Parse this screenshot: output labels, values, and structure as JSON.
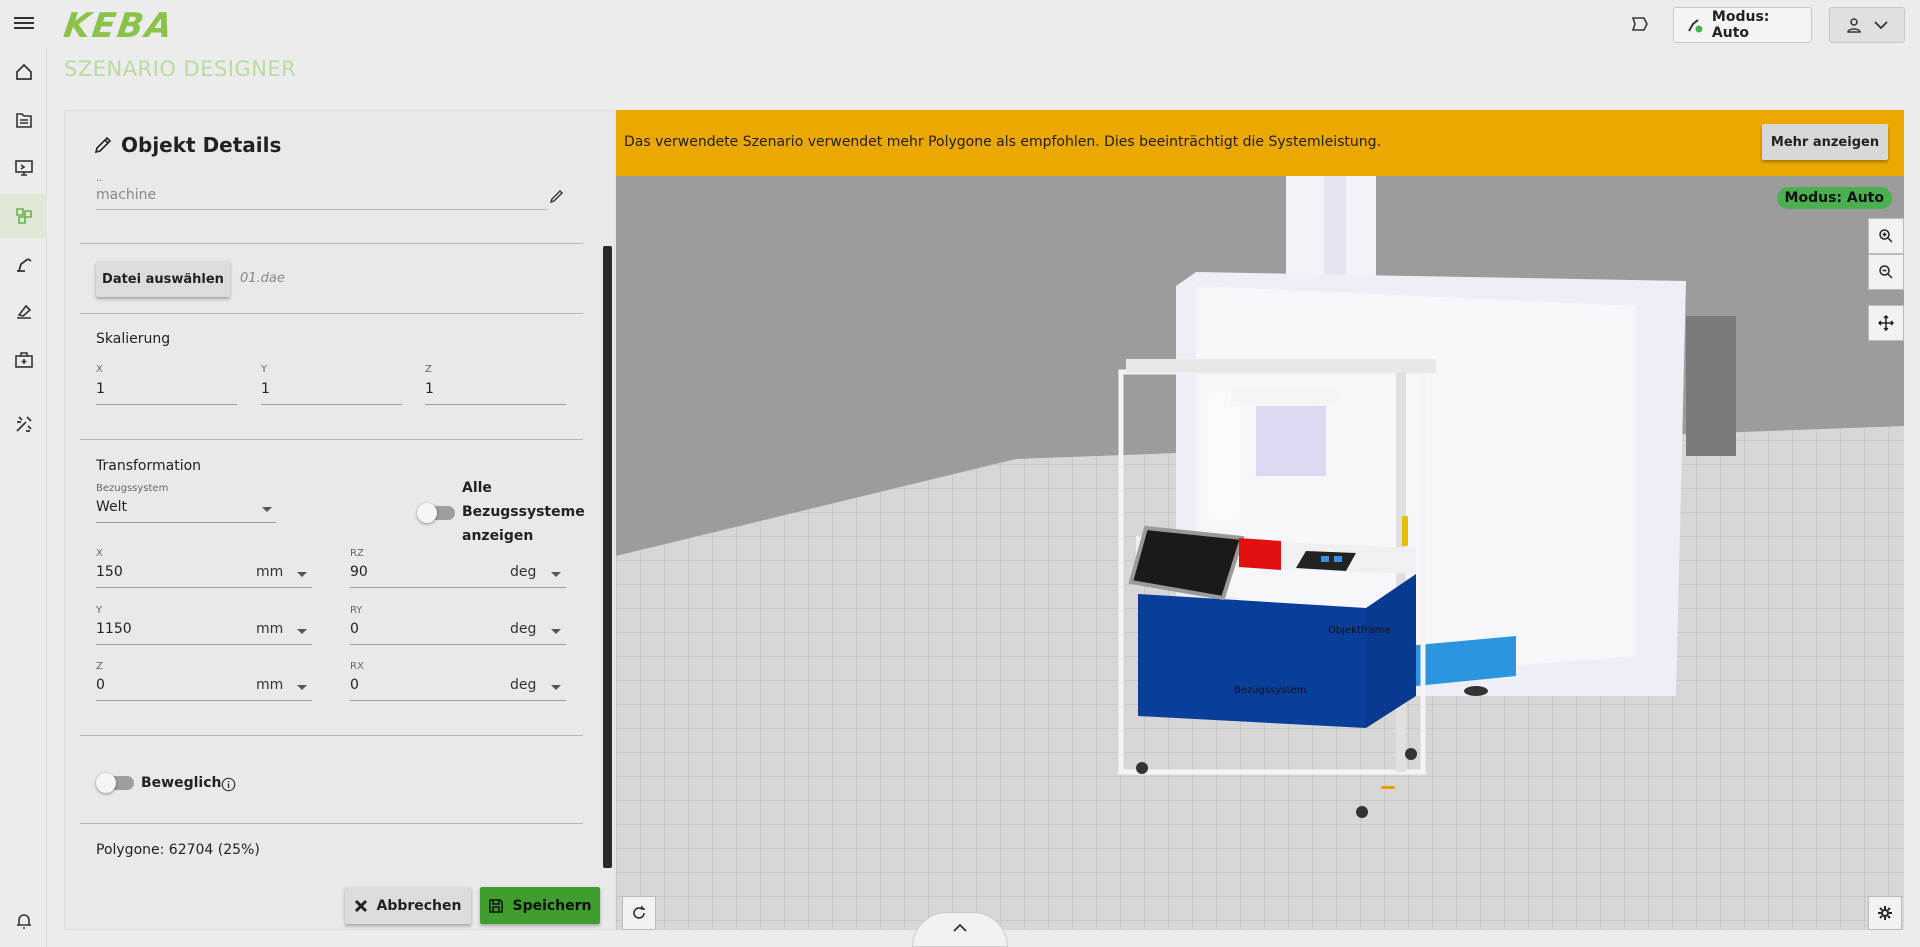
{
  "header": {
    "logo": "KEBA",
    "mode_button": "Modus: Auto",
    "menu_icon": "menu-icon",
    "user_icon": "user-icon"
  },
  "page": {
    "title": "SZENARIO DESIGNER"
  },
  "nav": {
    "items": [
      "home-icon",
      "document-icon",
      "monitor-icon",
      "scenario-icon",
      "robot-arm-icon",
      "teach-icon",
      "toolbox-icon",
      "tools-icon"
    ],
    "bottom": "bell-icon",
    "active_index": 3
  },
  "panel": {
    "title": "Objekt Details",
    "name_value": "machine",
    "file_button": "Datei auswählen",
    "file_name": "01.dae",
    "scaling": {
      "title": "Skalierung",
      "x_label": "X",
      "x": "1",
      "y_label": "Y",
      "y": "1",
      "z_label": "Z",
      "z": "1"
    },
    "transform": {
      "title": "Transformation",
      "ref_label": "Bezugssystem",
      "ref_value": "Welt",
      "toggle_label_1": "Alle",
      "toggle_label_2": "Bezugssysteme",
      "toggle_label_3": "anzeigen",
      "x_label": "X",
      "x": "150",
      "x_unit": "mm",
      "y_label": "Y",
      "y": "1150",
      "y_unit": "mm",
      "z_label": "Z",
      "z": "0",
      "z_unit": "mm",
      "rz_label": "RZ",
      "rz": "90",
      "rz_unit": "deg",
      "ry_label": "RY",
      "ry": "0",
      "ry_unit": "deg",
      "rx_label": "RX",
      "rx": "0",
      "rx_unit": "deg"
    },
    "movable_label": "Beweglich",
    "polygons": "Polygone: 62704 (25%)",
    "cancel": "Abbrechen",
    "save": "Speichern"
  },
  "viewport": {
    "warning": "Das verwendete Szenario verwendet mehr Polygone als empfohlen. Dies beeinträchtigt die Systemleistung.",
    "more_button": "Mehr anzeigen",
    "mode_badge": "Modus: Auto",
    "label_objectframe": "Objektframe",
    "label_refsystem": "Bezugssystem"
  },
  "colors": {
    "accent": "#8bc34a",
    "warning": "#eba800",
    "save": "#3f9e2e"
  }
}
